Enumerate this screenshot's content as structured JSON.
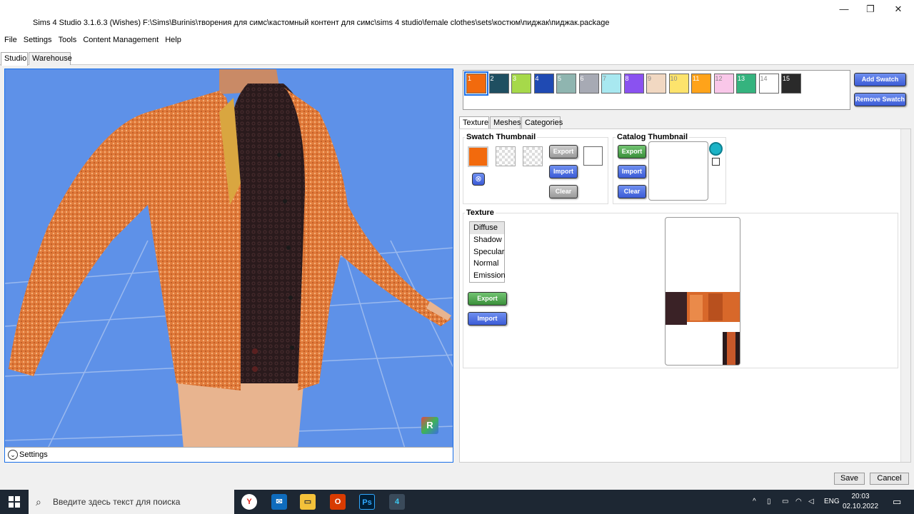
{
  "window": {
    "title": "Sims 4 Studio 3.1.6.3 (Wishes)  F:\\Sims\\Burinis\\творения для симс\\кастомный контент для симс\\sims 4 studio\\female clothes\\sets\\костюм\\пиджак\\пиджак.package",
    "minimize": "—",
    "restore": "❐",
    "close": "✕"
  },
  "menu": [
    "File",
    "Settings",
    "Tools",
    "Content Management",
    "Help"
  ],
  "main_tabs": [
    "Studio",
    "Warehouse"
  ],
  "viewport": {
    "settings_label": "Settings",
    "nav_cube_label": "R"
  },
  "swatches": [
    {
      "label": "1",
      "color": "#f26a0d"
    },
    {
      "label": "2",
      "color": "#1f4f61"
    },
    {
      "label": "3",
      "color": "#a6d94a"
    },
    {
      "label": "4",
      "color": "#1f4ab3"
    },
    {
      "label": "5",
      "color": "#8fb5b0"
    },
    {
      "label": "6",
      "color": "#a7aab4"
    },
    {
      "label": "7",
      "color": "#a8e8f0"
    },
    {
      "label": "8",
      "color": "#8a52f0"
    },
    {
      "label": "9",
      "color": "#f1d8c2"
    },
    {
      "label": "10",
      "color": "#fde36c"
    },
    {
      "label": "11",
      "color": "#ffa31a"
    },
    {
      "label": "12",
      "color": "#f9c7e9"
    },
    {
      "label": "13",
      "color": "#35b37e"
    },
    {
      "label": "14",
      "color": "#ffffff"
    },
    {
      "label": "15",
      "color": "#2a2a2a"
    }
  ],
  "swatch_buttons": {
    "add": "Add Swatch",
    "remove": "Remove Swatch"
  },
  "sub_tabs": [
    "Texture",
    "Meshes",
    "Categories"
  ],
  "swatch_thumbnail": {
    "title": "Swatch Thumbnail",
    "export": "Export",
    "import": "Import",
    "clear": "Clear",
    "color": "#f26a0d"
  },
  "catalog_thumbnail": {
    "title": "Catalog Thumbnail",
    "export": "Export",
    "import": "Import",
    "clear": "Clear"
  },
  "texture": {
    "title": "Texture",
    "channels": [
      "Diffuse",
      "Shadow",
      "Specular",
      "Normal",
      "Emission"
    ],
    "selected": "Diffuse",
    "export": "Export",
    "import": "Import"
  },
  "footer": {
    "save": "Save",
    "cancel": "Cancel"
  },
  "taskbar": {
    "search_placeholder": "Введите здесь текст для поиска",
    "language": "ENG",
    "time": "20:03",
    "date": "02.10.2022"
  }
}
